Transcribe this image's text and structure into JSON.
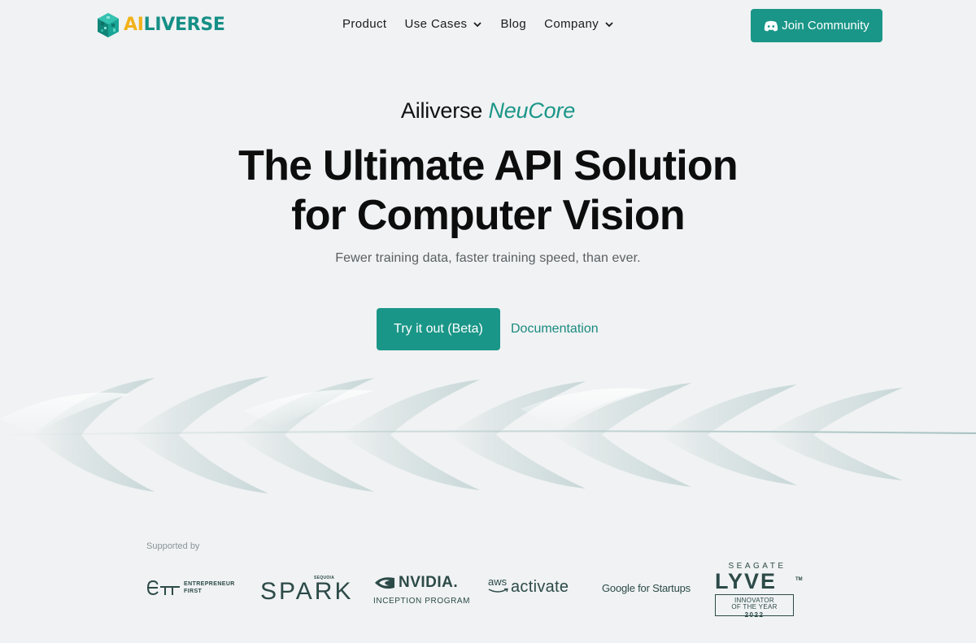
{
  "brand": {
    "logo_ai": "AI",
    "logo_rest": "LIVERSE",
    "colors": {
      "primary": "#1a9688",
      "logo_yellow": "#f2b21a",
      "background": "#f0f2f3"
    }
  },
  "nav": {
    "links": [
      {
        "label": "Product",
        "has_dropdown": false
      },
      {
        "label": "Use Cases",
        "has_dropdown": true
      },
      {
        "label": "Blog",
        "has_dropdown": false
      },
      {
        "label": "Company",
        "has_dropdown": true
      }
    ],
    "join_button": {
      "label": "Join Community",
      "icon": "discord-icon"
    }
  },
  "hero": {
    "eyebrow_prefix": "Ailiverse",
    "eyebrow_accent": "NeuCore",
    "headline_line1": "The Ultimate API Solution",
    "headline_line2": "for Computer Vision",
    "subtitle": "Fewer training data, faster training speed, than ever.",
    "cta_primary": "Try it out (Beta)",
    "cta_secondary": "Documentation"
  },
  "supporters": {
    "label": "Supported by",
    "entrepreneur_first": {
      "line1": "ENTREPRENEUR",
      "line2": "FIRST"
    },
    "spark": {
      "top": "SEQUOIA",
      "main": "SPARK"
    },
    "nvidia": {
      "name": "NVIDIA.",
      "program": "INCEPTION PROGRAM"
    },
    "aws": {
      "logo": "aws",
      "word": "activate"
    },
    "google": {
      "text": "Google for Startups"
    },
    "lyve": {
      "top": "SEAGATE",
      "main": "LYVE",
      "tm": "TM",
      "line1": "INNOVATOR",
      "line2": "OF THE YEAR",
      "year": "2022"
    }
  }
}
